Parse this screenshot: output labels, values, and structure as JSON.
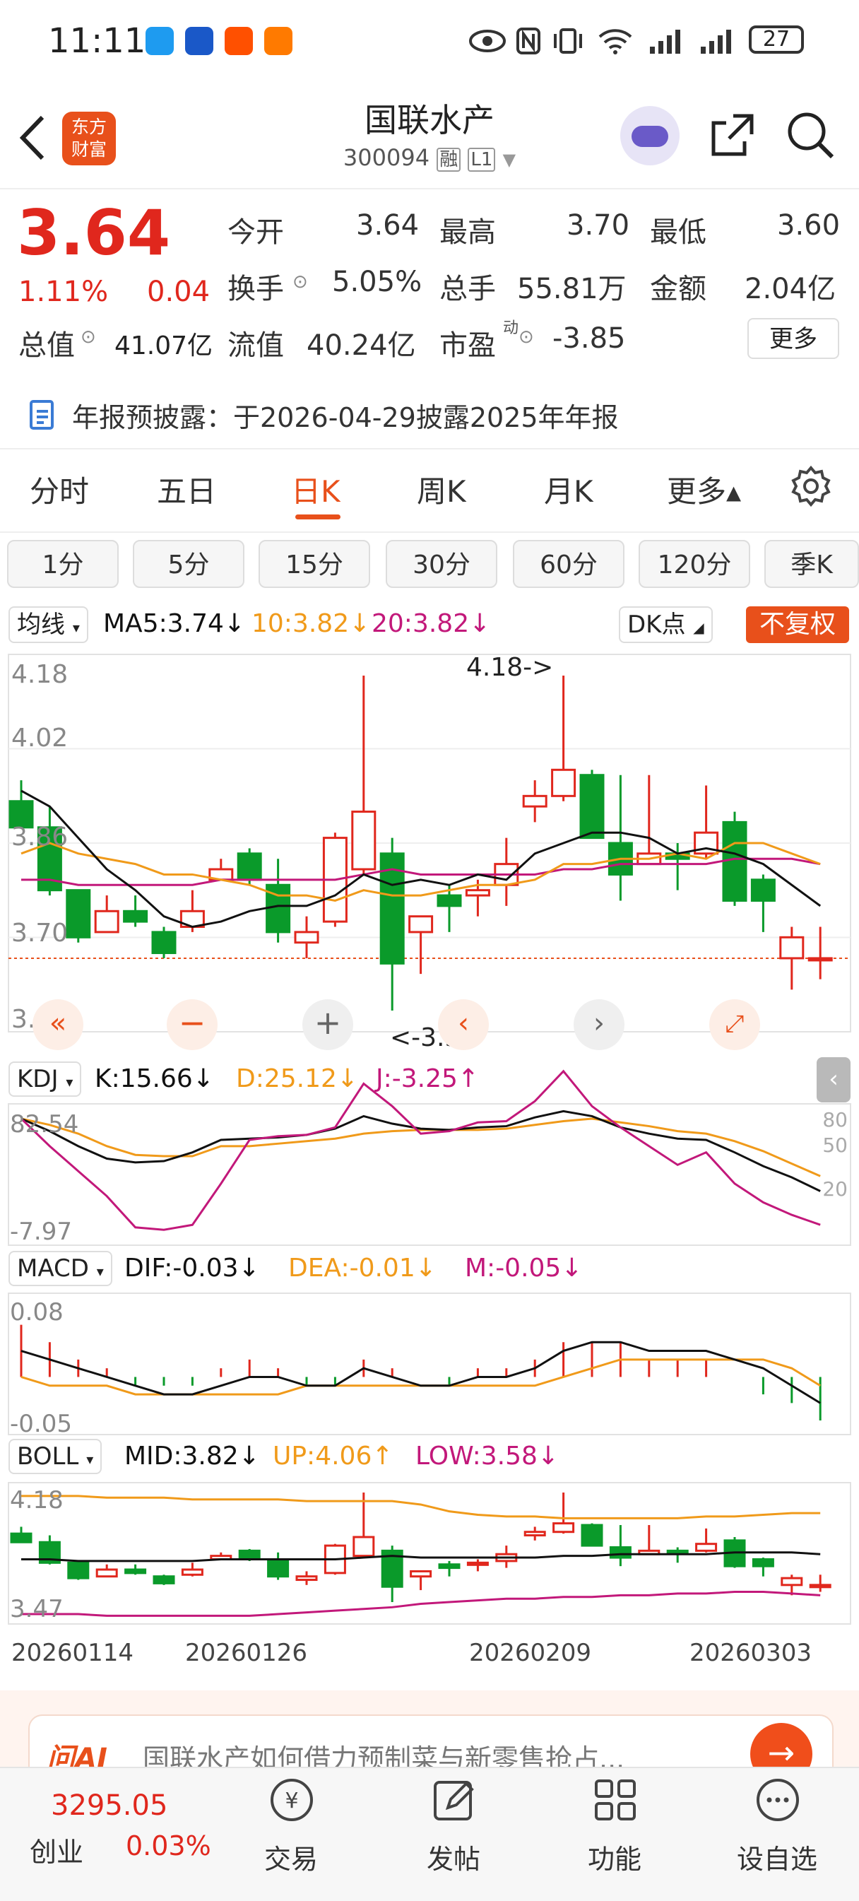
{
  "status_bar": {
    "time": "11:11",
    "battery": "27"
  },
  "header": {
    "title": "国联水产",
    "code": "300094",
    "tag_rong": "融",
    "tag_level": "L1",
    "logo_line1": "东方",
    "logo_line2": "财富"
  },
  "quote": {
    "price": "3.64",
    "change_pct": "1.11%",
    "change": "0.04",
    "open_label": "今开",
    "open": "3.64",
    "high_label": "最高",
    "high": "3.70",
    "low_label": "最低",
    "low": "3.60",
    "turnover_label": "换手",
    "turnover": "5.05%",
    "volume_label": "总手",
    "volume": "55.81万",
    "amount_label": "金额",
    "amount": "2.04亿",
    "mktcap_label": "总值",
    "mktcap": "41.07亿",
    "float_label": "流值",
    "float_cap": "40.24亿",
    "pe_label": "市盈",
    "pe_sup": "动",
    "pe": "-3.85",
    "more_button": "更多"
  },
  "notice": {
    "text": "年报预披露：于2026-04-29披露2025年年报"
  },
  "period_tabs": [
    "分时",
    "五日",
    "日K",
    "周K",
    "月K",
    "更多▴"
  ],
  "active_tab": "日K",
  "minute_pills": [
    "1分",
    "5分",
    "15分",
    "30分",
    "60分",
    "120分",
    "季K"
  ],
  "ma_bar": {
    "selector": "均线",
    "ma5": "MA5:3.74↓",
    "ma10": "10:3.82↓",
    "ma20": "20:3.82↓",
    "dk": "DK点",
    "fuquan": "不复权"
  },
  "main_chart": {
    "y_labels": [
      "4.18",
      "4.02",
      "3.86",
      "3.70",
      "3.54"
    ],
    "max_note": "4.18->",
    "min_note": "<-3.54"
  },
  "kdj": {
    "selector": "KDJ",
    "k": "K:15.66↓",
    "d": "D:25.12↓",
    "j": "J:-3.25↑",
    "top": "82.54",
    "bottom": "-7.97",
    "right": [
      "80",
      "50",
      "20"
    ]
  },
  "macd": {
    "selector": "MACD",
    "dif": "DIF:-0.03↓",
    "dea": "DEA:-0.01↓",
    "m": "M:-0.05↓",
    "top": "0.08",
    "bottom": "-0.05"
  },
  "boll": {
    "selector": "BOLL",
    "mid": "MID:3.82↓",
    "up": "UP:4.06↑",
    "low": "LOW:3.58↓",
    "top": "4.18",
    "bottom": "3.47"
  },
  "x_dates": [
    "20260114",
    "20260126",
    "20260209",
    "20260303"
  ],
  "ai_banner": {
    "logo": "问AI",
    "text": "国联水产如何借力预制菜与新零售抢占..."
  },
  "footer": {
    "index_value": "3295.05",
    "index_name": "创业",
    "index_pct": "0.03%",
    "items": [
      "交易",
      "发帖",
      "功能",
      "设自选"
    ]
  },
  "colors": {
    "up": "#e0271d",
    "down": "#0a9a2a",
    "accent": "#e8501b",
    "ma5": "#111111",
    "ma10": "#f09a1a",
    "ma20": "#c2187a"
  },
  "chart_data": {
    "type": "candlestick",
    "ohlc": [
      [
        3.94,
        3.98,
        3.9,
        3.89
      ],
      [
        3.89,
        3.93,
        3.76,
        3.77
      ],
      [
        3.77,
        3.77,
        3.67,
        3.68
      ],
      [
        3.69,
        3.76,
        3.7,
        3.73
      ],
      [
        3.73,
        3.76,
        3.7,
        3.71
      ],
      [
        3.69,
        3.7,
        3.64,
        3.65
      ],
      [
        3.7,
        3.77,
        3.69,
        3.73
      ],
      [
        3.79,
        3.83,
        3.79,
        3.81
      ],
      [
        3.84,
        3.85,
        3.78,
        3.79
      ],
      [
        3.78,
        3.83,
        3.67,
        3.69
      ],
      [
        3.67,
        3.72,
        3.64,
        3.69
      ],
      [
        3.71,
        3.88,
        3.7,
        3.87
      ],
      [
        3.81,
        4.18,
        3.8,
        3.92
      ],
      [
        3.84,
        3.87,
        3.54,
        3.63
      ],
      [
        3.69,
        3.72,
        3.61,
        3.72
      ],
      [
        3.76,
        3.78,
        3.69,
        3.74
      ],
      [
        3.76,
        3.79,
        3.72,
        3.77
      ],
      [
        3.78,
        3.87,
        3.74,
        3.82
      ],
      [
        3.93,
        3.98,
        3.9,
        3.95
      ],
      [
        3.95,
        4.18,
        3.94,
        4.0
      ],
      [
        3.99,
        4.0,
        3.87,
        3.87
      ],
      [
        3.86,
        3.99,
        3.75,
        3.8
      ],
      [
        3.82,
        3.99,
        3.82,
        3.84
      ],
      [
        3.84,
        3.86,
        3.77,
        3.83
      ],
      [
        3.84,
        3.97,
        3.83,
        3.88
      ],
      [
        3.9,
        3.92,
        3.74,
        3.75
      ],
      [
        3.79,
        3.8,
        3.69,
        3.75
      ],
      [
        3.64,
        3.7,
        3.58,
        3.68
      ],
      [
        3.64,
        3.7,
        3.6,
        3.64
      ]
    ],
    "ma5": [
      3.96,
      3.93,
      3.87,
      3.81,
      3.77,
      3.72,
      3.7,
      3.71,
      3.73,
      3.74,
      3.74,
      3.76,
      3.8,
      3.78,
      3.79,
      3.78,
      3.8,
      3.79,
      3.84,
      3.86,
      3.88,
      3.88,
      3.87,
      3.84,
      3.85,
      3.84,
      3.82,
      3.78,
      3.74
    ],
    "ma10": [
      3.84,
      3.86,
      3.84,
      3.83,
      3.82,
      3.8,
      3.8,
      3.79,
      3.78,
      3.76,
      3.76,
      3.75,
      3.77,
      3.76,
      3.76,
      3.77,
      3.78,
      3.78,
      3.79,
      3.82,
      3.82,
      3.83,
      3.83,
      3.84,
      3.83,
      3.86,
      3.86,
      3.84,
      3.82
    ],
    "ma20": [
      3.79,
      3.79,
      3.78,
      3.78,
      3.78,
      3.78,
      3.78,
      3.79,
      3.79,
      3.79,
      3.79,
      3.79,
      3.8,
      3.81,
      3.8,
      3.8,
      3.8,
      3.8,
      3.8,
      3.81,
      3.81,
      3.82,
      3.82,
      3.82,
      3.82,
      3.83,
      3.83,
      3.83,
      3.82
    ],
    "kdj_k": [
      82,
      72,
      60,
      50,
      47,
      48,
      55,
      65,
      66,
      67,
      69,
      74,
      84,
      78,
      74,
      73,
      75,
      76,
      83,
      88,
      84,
      75,
      70,
      66,
      65,
      55,
      44,
      35,
      24
    ],
    "kdj_d": [
      82,
      77,
      70,
      60,
      53,
      52,
      52,
      60,
      60,
      62,
      64,
      66,
      70,
      72,
      73,
      73,
      73,
      74,
      77,
      80,
      82,
      79,
      76,
      72,
      70,
      64,
      56,
      46,
      36
    ],
    "kdj_j": [
      82,
      60,
      40,
      20,
      -5,
      -7,
      -3,
      30,
      65,
      68,
      69,
      75,
      110,
      92,
      70,
      72,
      79,
      80,
      96,
      120,
      92,
      75,
      60,
      45,
      55,
      30,
      15,
      5,
      -3
    ],
    "macd_dif": [
      0.03,
      0.02,
      0.01,
      0.0,
      -0.01,
      -0.02,
      -0.02,
      -0.01,
      0.0,
      0.0,
      -0.01,
      -0.01,
      0.01,
      0.0,
      -0.01,
      -0.01,
      0.0,
      0.0,
      0.01,
      0.03,
      0.04,
      0.04,
      0.03,
      0.03,
      0.03,
      0.02,
      0.01,
      -0.01,
      -0.03
    ],
    "macd_dea": [
      0.0,
      -0.01,
      -0.01,
      -0.01,
      -0.02,
      -0.02,
      -0.02,
      -0.02,
      -0.02,
      -0.02,
      -0.01,
      -0.01,
      -0.01,
      -0.01,
      -0.01,
      -0.01,
      -0.01,
      -0.01,
      -0.01,
      0.0,
      0.01,
      0.02,
      0.02,
      0.02,
      0.02,
      0.02,
      0.02,
      0.01,
      -0.01
    ],
    "macd_m": [
      0.06,
      0.04,
      0.02,
      0.01,
      -0.01,
      -0.01,
      -0.01,
      0.01,
      0.02,
      0.01,
      -0.01,
      -0.01,
      0.02,
      0.01,
      0.0,
      -0.01,
      0.01,
      0.01,
      0.02,
      0.04,
      0.04,
      0.04,
      0.02,
      0.02,
      0.02,
      0.0,
      -0.02,
      -0.03,
      -0.05
    ],
    "boll_mid": [
      3.79,
      3.79,
      3.78,
      3.78,
      3.78,
      3.78,
      3.78,
      3.79,
      3.79,
      3.79,
      3.79,
      3.79,
      3.8,
      3.81,
      3.8,
      3.8,
      3.8,
      3.8,
      3.8,
      3.81,
      3.81,
      3.82,
      3.82,
      3.82,
      3.82,
      3.83,
      3.83,
      3.83,
      3.82
    ],
    "boll_up": [
      4.16,
      4.16,
      4.16,
      4.15,
      4.15,
      4.15,
      4.14,
      4.14,
      4.14,
      4.14,
      4.13,
      4.13,
      4.13,
      4.13,
      4.11,
      4.07,
      4.05,
      4.04,
      4.04,
      4.03,
      4.03,
      4.03,
      4.03,
      4.03,
      4.04,
      4.04,
      4.05,
      4.06,
      4.06
    ],
    "boll_low": [
      3.47,
      3.47,
      3.47,
      3.46,
      3.46,
      3.46,
      3.46,
      3.46,
      3.46,
      3.47,
      3.48,
      3.49,
      3.5,
      3.51,
      3.53,
      3.54,
      3.55,
      3.56,
      3.56,
      3.57,
      3.57,
      3.58,
      3.58,
      3.59,
      3.59,
      3.6,
      3.6,
      3.59,
      3.58
    ],
    "ylim_main": [
      3.54,
      4.18
    ],
    "ylim_kdj": [
      -7.97,
      82.54
    ],
    "ylim_macd": [
      -0.05,
      0.08
    ],
    "ylim_boll": [
      3.47,
      4.18
    ]
  }
}
